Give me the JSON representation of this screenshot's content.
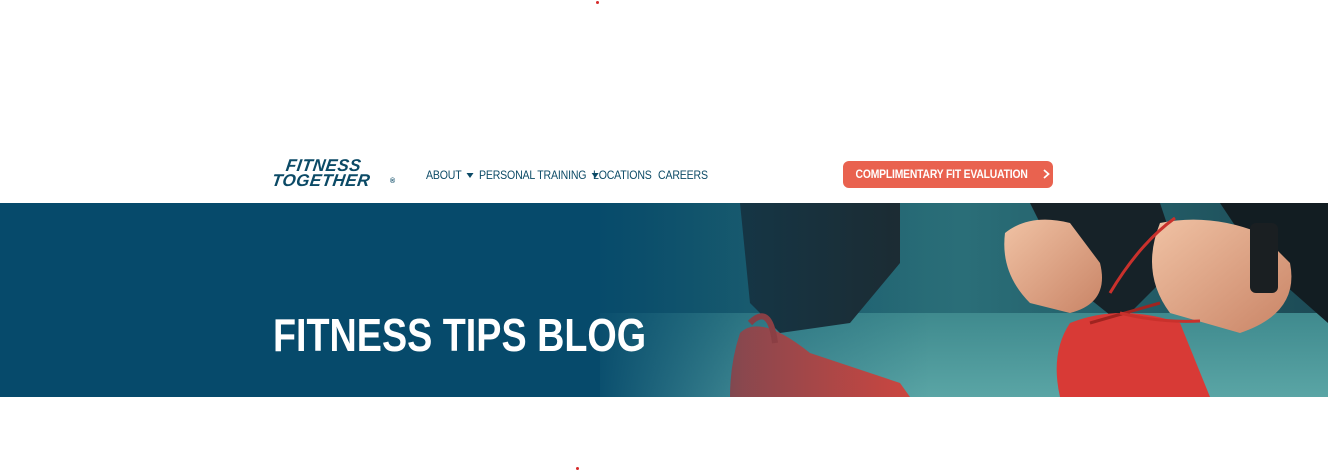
{
  "brand": {
    "logo_line1": "FITNESS",
    "logo_line2": "TOGETHER",
    "logo_mark": "®"
  },
  "nav": {
    "items": [
      {
        "label": "ABOUT",
        "has_dropdown": true
      },
      {
        "label": "PERSONAL TRAINING",
        "has_dropdown": true
      },
      {
        "label": "LOCATIONS",
        "has_dropdown": false
      },
      {
        "label": "CAREERS",
        "has_dropdown": false
      }
    ]
  },
  "cta": {
    "label": "COMPLIMENTARY FIT EVALUATION",
    "icon": "chevron-right-icon"
  },
  "hero": {
    "title": "FITNESS TIPS BLOG",
    "image": "runner-tying-red-shoelace"
  },
  "colors": {
    "brand_navy": "#0b4a66",
    "hero_blue": "#064a6b",
    "cta_coral": "#e9624f",
    "accent_red": "#d62a2a",
    "white": "#ffffff"
  }
}
